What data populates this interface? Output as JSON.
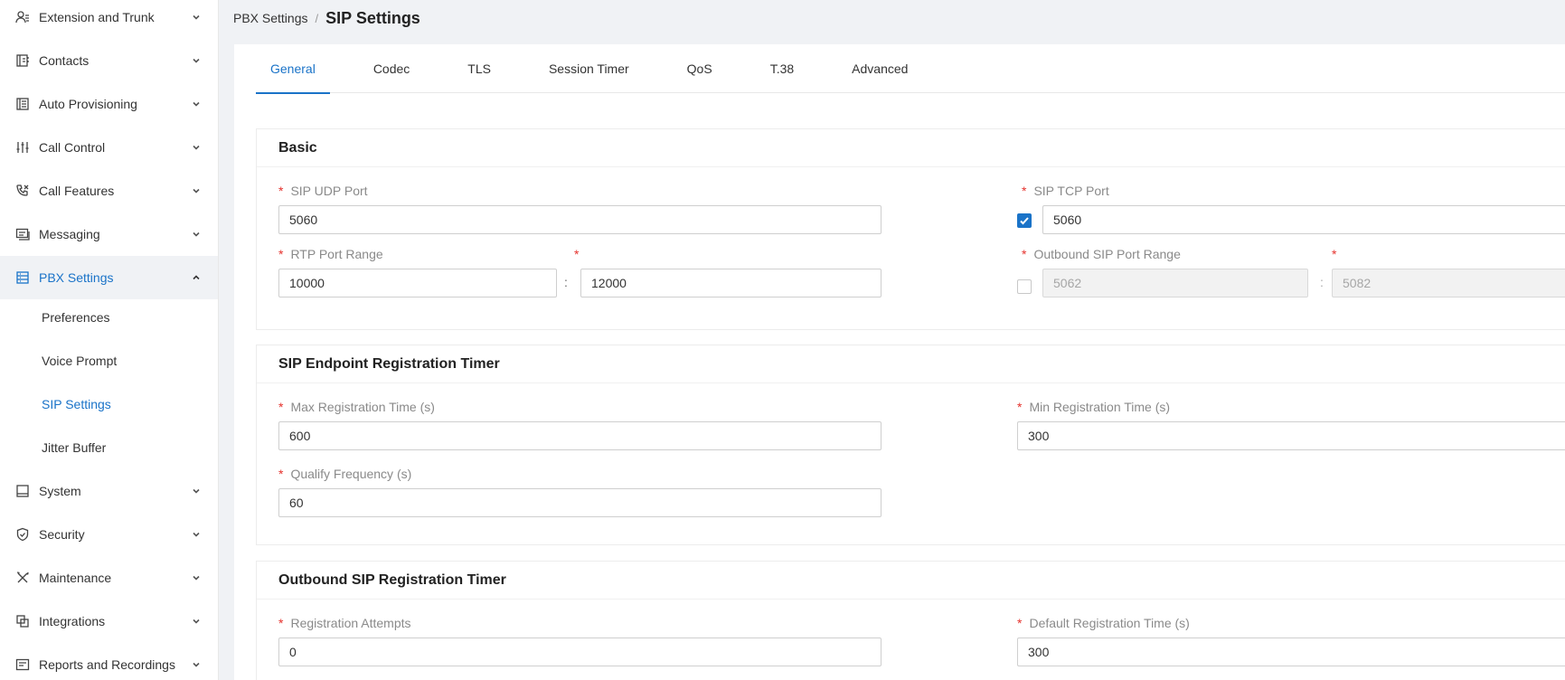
{
  "sidebar": {
    "items": [
      {
        "label": "Extension and Trunk",
        "icon": "user-list-icon"
      },
      {
        "label": "Contacts",
        "icon": "contacts-book-icon"
      },
      {
        "label": "Auto Provisioning",
        "icon": "provisioning-icon"
      },
      {
        "label": "Call Control",
        "icon": "sliders-icon"
      },
      {
        "label": "Call Features",
        "icon": "phone-icon"
      },
      {
        "label": "Messaging",
        "icon": "message-icon"
      },
      {
        "label": "PBX Settings",
        "icon": "pbx-settings-icon"
      },
      {
        "label": "System",
        "icon": "monitor-icon"
      },
      {
        "label": "Security",
        "icon": "shield-icon"
      },
      {
        "label": "Maintenance",
        "icon": "tools-icon"
      },
      {
        "label": "Integrations",
        "icon": "integrations-icon"
      },
      {
        "label": "Reports and Recordings",
        "icon": "reports-icon"
      }
    ],
    "sub_items": [
      "Preferences",
      "Voice Prompt",
      "SIP Settings",
      "Jitter Buffer"
    ]
  },
  "breadcrumb": {
    "parent": "PBX Settings",
    "separator": "/",
    "current": "SIP Settings"
  },
  "tabs": [
    "General",
    "Codec",
    "TLS",
    "Session Timer",
    "QoS",
    "T.38",
    "Advanced"
  ],
  "basic": {
    "title": "Basic",
    "sip_udp_port": {
      "label": "SIP UDP Port",
      "value": "5060"
    },
    "sip_tcp_port": {
      "label": "SIP TCP Port",
      "value": "5060",
      "enabled": true
    },
    "rtp_port_range": {
      "label": "RTP Port Range",
      "from": "10000",
      "to": "12000"
    },
    "outbound_sip_port_range": {
      "label": "Outbound SIP Port Range",
      "from": "5062",
      "to": "5082",
      "enabled": false
    },
    "range_separator": ":"
  },
  "endpoint_timer": {
    "title": "SIP Endpoint Registration Timer",
    "max_registration": {
      "label": "Max Registration Time (s)",
      "value": "600"
    },
    "min_registration": {
      "label": "Min Registration Time (s)",
      "value": "300"
    },
    "qualify_frequency": {
      "label": "Qualify Frequency (s)",
      "value": "60"
    }
  },
  "outbound_timer": {
    "title": "Outbound SIP Registration Timer",
    "registration_attempts": {
      "label": "Registration Attempts",
      "value": "0"
    },
    "default_registration": {
      "label": "Default Registration Time (s)",
      "value": "300"
    }
  },
  "required_mark": "*",
  "colors": {
    "accent": "#1a73c8",
    "required": "#e5322d",
    "background": "#f0f2f5"
  }
}
